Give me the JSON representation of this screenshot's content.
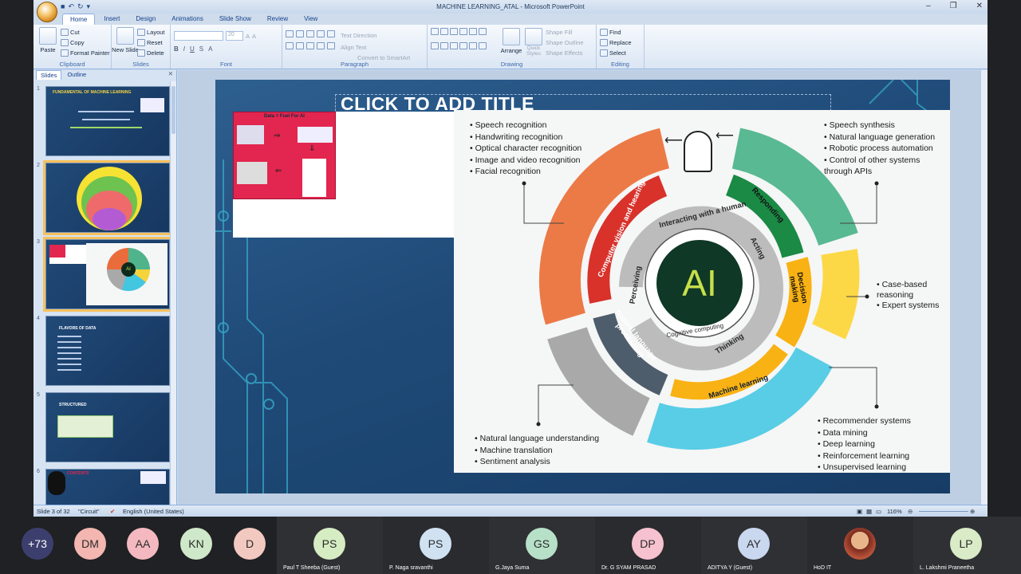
{
  "app": {
    "title": "MACHINE LEARNING_ATAL - Microsoft PowerPoint"
  },
  "ribbon": {
    "tabs": [
      "Home",
      "Insert",
      "Design",
      "Animations",
      "Slide Show",
      "Review",
      "View"
    ],
    "clipboard": {
      "label": "Clipboard",
      "paste": "Paste",
      "cut": "Cut",
      "copy": "Copy",
      "format_painter": "Format Painter"
    },
    "slides": {
      "label": "Slides",
      "new_slide": "New Slide",
      "layout": "Layout",
      "reset": "Reset",
      "delete": "Delete"
    },
    "font": {
      "label": "Font",
      "size": "20"
    },
    "paragraph": {
      "label": "Paragraph",
      "text_direction": "Text Direction",
      "align_text": "Align Text",
      "smartart": "Convert to SmartArt"
    },
    "drawing": {
      "label": "Drawing",
      "arrange": "Arrange",
      "quick_styles": "Quick Styles",
      "shape_fill": "Shape Fill",
      "shape_outline": "Shape Outline",
      "shape_effects": "Shape Effects"
    },
    "editing": {
      "label": "Editing",
      "find": "Find",
      "replace": "Replace",
      "select": "Select"
    }
  },
  "panel": {
    "tabs": [
      "Slides",
      "Outline"
    ],
    "thumbs": [
      {
        "num": "1",
        "title": "FUNDAMENTAL OF MACHINE LEARNING"
      },
      {
        "num": "2",
        "title": ""
      },
      {
        "num": "3",
        "title": ""
      },
      {
        "num": "4",
        "title": "FLAVORS OF DATA"
      },
      {
        "num": "5",
        "title": "STRUCTURED"
      },
      {
        "num": "6",
        "title": "CONTENTS"
      }
    ]
  },
  "slide": {
    "title": "CLICK TO ADD TITLE",
    "fuel": {
      "title": "Data = Fuel For AI"
    },
    "ai": {
      "center": "AI",
      "inner_ring": [
        "Interacting with a human",
        "Acting",
        "Perceiving",
        "Thinking"
      ],
      "inner_caption": "Cognitive computing",
      "outer_ring": [
        "Computer vision and hearing",
        "Responding",
        "Decision making",
        "Natural language processing",
        "Machine learning"
      ],
      "top_left": [
        "Speech recognition",
        "Handwriting recognition",
        "Optical character recognition",
        "Image and video recognition",
        "Facial recognition"
      ],
      "top_right": [
        "Speech synthesis",
        "Natural language generation",
        "Robotic process automation",
        "Control of other systems through APIs"
      ],
      "mid_right": [
        "Case-based reasoning",
        "Expert systems"
      ],
      "bottom_left": [
        "Natural language understanding",
        "Machine translation",
        "Sentiment analysis"
      ],
      "bottom_right": [
        "Recommender systems",
        "Data mining",
        "Deep learning",
        "Reinforcement learning",
        "Unsupervised learning"
      ]
    }
  },
  "status": {
    "slide": "Slide 3 of 32",
    "theme": "\"Circuit\"",
    "lang": "English (United States)",
    "zoom": "116%"
  },
  "meet": {
    "avatars": [
      {
        "initials": "+73",
        "color": "#3c3f6e"
      },
      {
        "initials": "DM",
        "color": "#f3b6b0"
      },
      {
        "initials": "AA",
        "color": "#f4b9c0"
      },
      {
        "initials": "KN",
        "color": "#cfe8c9"
      },
      {
        "initials": "D",
        "color": "#f2c9c0"
      }
    ],
    "tiles": [
      {
        "initials": "PS",
        "name": "Paul  T Sheeba (Guest)",
        "color": "#d6ecc3"
      },
      {
        "initials": "PS",
        "name": "P. Naga sravanthi",
        "color": "#d0e2f2"
      },
      {
        "initials": "GS",
        "name": "G.Jaya Suma",
        "color": "#b7e0c8"
      },
      {
        "initials": "DP",
        "name": "Dr. G SYAM PRASAD",
        "color": "#f6c2cf"
      },
      {
        "initials": "AY",
        "name": "ADITYA Y (Guest)",
        "color": "#c9d7ef"
      },
      {
        "initials": "",
        "name": "HoD IT",
        "color": "#b9543a"
      },
      {
        "initials": "LP",
        "name": "L. Lakshmi Praneetha",
        "color": "#d9ebc7"
      }
    ]
  }
}
